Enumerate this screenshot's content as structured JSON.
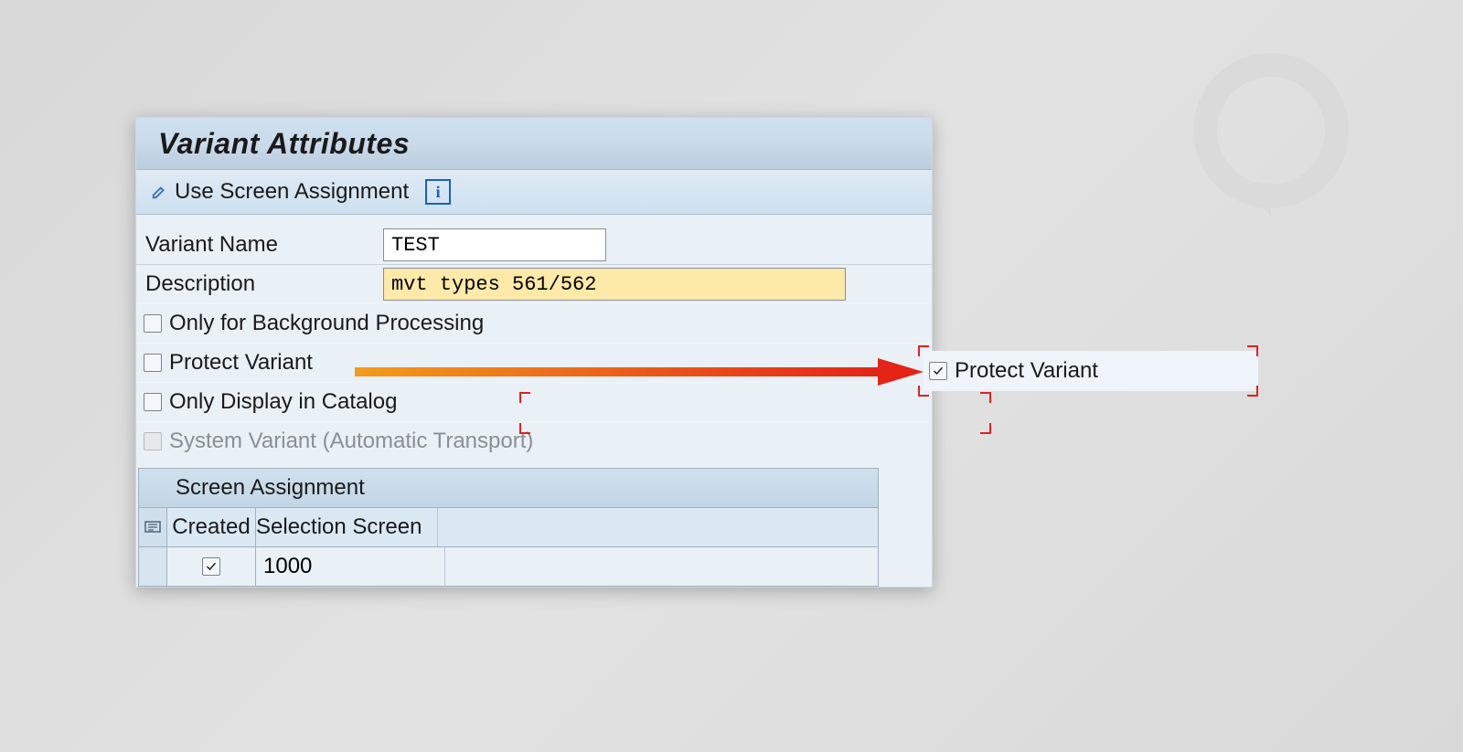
{
  "title": "Variant Attributes",
  "toolbar": {
    "use_screen_assignment": "Use Screen Assignment",
    "info_tooltip": "i"
  },
  "form": {
    "variant_name_label": "Variant Name",
    "variant_name_value": "TEST",
    "description_label": "Description",
    "description_value": "mvt types 561/562",
    "checkboxes": {
      "only_background": {
        "label": "Only for Background Processing",
        "checked": false
      },
      "protect_variant": {
        "label": "Protect Variant",
        "checked": false
      },
      "only_display_catalog": {
        "label": "Only Display in Catalog",
        "checked": false
      },
      "system_variant": {
        "label": "System Variant (Automatic Transport)",
        "checked": false,
        "disabled": true
      }
    }
  },
  "assign": {
    "heading": "Screen Assignment",
    "col_created": "Created",
    "col_selection_screen": "Selection Screen",
    "rows": [
      {
        "created": true,
        "screen": "1000"
      }
    ]
  },
  "callout": {
    "protect_variant_label": "Protect Variant",
    "protect_variant_checked": true
  }
}
